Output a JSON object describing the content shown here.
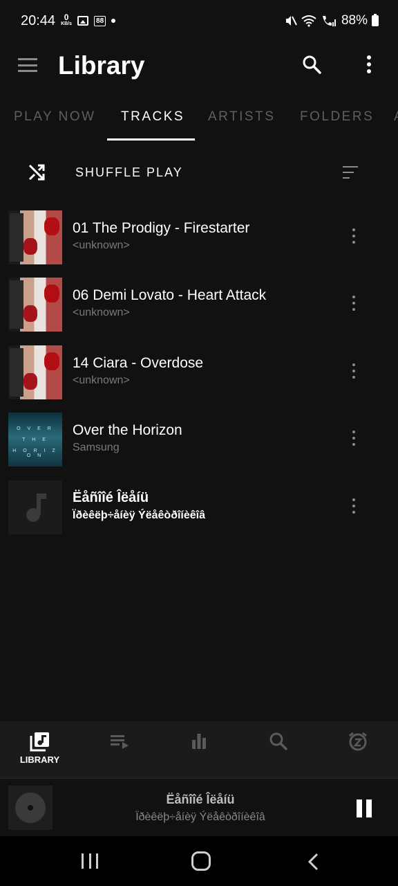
{
  "status_bar": {
    "time": "20:44",
    "speed_value": "0",
    "speed_unit": "KB/s",
    "notif_badge": "88",
    "battery": "88%"
  },
  "app_bar": {
    "title": "Library"
  },
  "tabs": [
    "PLAY NOW",
    "TRACKS",
    "ARTISTS",
    "FOLDERS",
    "A"
  ],
  "active_tab": "TRACKS",
  "shuffle": {
    "label": "SHUFFLE PLAY"
  },
  "tracks": [
    {
      "title": "01 The Prodigy - Firestarter",
      "subtitle": "<unknown>",
      "art": "prodigy-cover"
    },
    {
      "title": "06 Demi Lovato - Heart Attack",
      "subtitle": "<unknown>",
      "art": "prodigy-cover"
    },
    {
      "title": "14 Ciara - Overdose",
      "subtitle": "<unknown>",
      "art": "prodigy-cover"
    },
    {
      "title": "Over the Horizon",
      "subtitle": "Samsung",
      "art": "horizon-cover"
    },
    {
      "title": "Ëåñîîé Îëåíü",
      "subtitle": "Ïðèêëþ÷åíèÿ Ýëåêòðîíèêîâ",
      "art": "music-note-icon"
    }
  ],
  "horizon_cover_lines": [
    "O V E R",
    "T H E",
    "H O R I Z O N"
  ],
  "bottom_nav": {
    "items": [
      {
        "label": "LIBRARY",
        "icon": "library-music-icon",
        "active": true
      },
      {
        "label": "",
        "icon": "queue-playlist-icon"
      },
      {
        "label": "",
        "icon": "equalizer-icon"
      },
      {
        "label": "",
        "icon": "search-icon"
      },
      {
        "label": "",
        "icon": "sleep-timer-icon"
      }
    ]
  },
  "mini_player": {
    "title": "Ëåñîîé Îëåíü",
    "artist": "Ïðèêëþ÷åíèÿ Ýëåêòðîíèêîâ",
    "state": "playing"
  },
  "colors": {
    "background": "#111111",
    "inactive_tab": "#5f5f5f",
    "nav_bar": "#1b1b1b",
    "secondary_text": "#7a7a7a"
  }
}
